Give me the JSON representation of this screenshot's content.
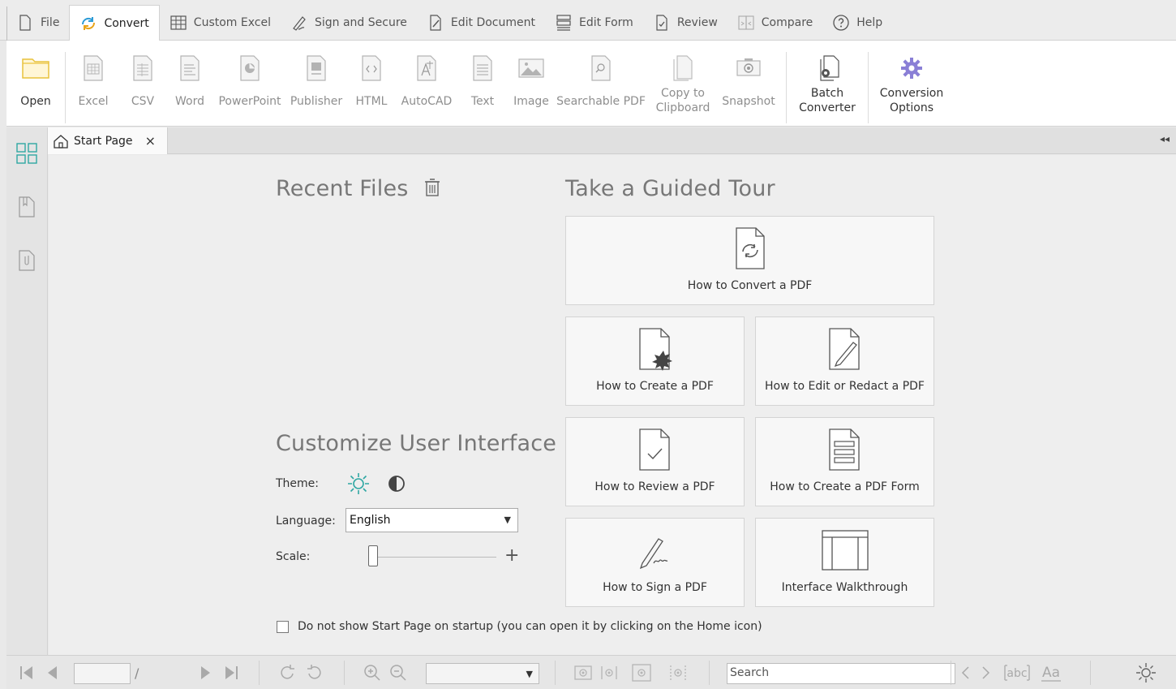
{
  "menu": {
    "tabs": [
      {
        "label": "File",
        "icon": "file-icon"
      },
      {
        "label": "Convert",
        "icon": "convert-icon"
      },
      {
        "label": "Custom Excel",
        "icon": "grid-icon"
      },
      {
        "label": "Sign and Secure",
        "icon": "signature-pen-icon"
      },
      {
        "label": "Edit Document",
        "icon": "edit-document-icon"
      },
      {
        "label": "Edit Form",
        "icon": "form-icon"
      },
      {
        "label": "Review",
        "icon": "review-check-icon"
      },
      {
        "label": "Compare",
        "icon": "compare-icon"
      },
      {
        "label": "Help",
        "icon": "help-icon"
      }
    ],
    "active": "Convert"
  },
  "ribbon": {
    "open": "Open",
    "excel": "Excel",
    "csv": "CSV",
    "word": "Word",
    "powerpoint": "PowerPoint",
    "publisher": "Publisher",
    "html": "HTML",
    "autocad": "AutoCAD",
    "text": "Text",
    "image": "Image",
    "searchable_pdf": "Searchable PDF",
    "copy_clipboard": "Copy to\nClipboard",
    "snapshot": "Snapshot",
    "batch_converter": "Batch\nConverter",
    "conversion_options": "Conversion\nOptions"
  },
  "doc_tab": {
    "label": "Start Page",
    "close": "×"
  },
  "collapse_glyph": "◂◂",
  "start_page": {
    "recent_files_title": "Recent Files",
    "guided_tour_title": "Take a Guided Tour",
    "tiles": {
      "convert": "How to Convert a PDF",
      "create": "How to Create a PDF",
      "edit": "How to Edit or Redact a PDF",
      "review": "How to Review a PDF",
      "create_form": "How to Create a PDF Form",
      "sign": "How to Sign a PDF",
      "walkthrough": "Interface Walkthrough"
    },
    "customize_title": "Customize User Interface",
    "theme_label": "Theme:",
    "language_label": "Language:",
    "language_value": "English",
    "scale_label": "Scale:",
    "scale_plus": "+",
    "scale_value": 0,
    "startup_checkbox_label": "Do not show Start Page on startup (you can open it by clicking on the Home icon)",
    "startup_checked": false
  },
  "statusbar": {
    "page_separator": "/",
    "search_placeholder": "Search"
  },
  "colors": {
    "accent_orange": "#e8a317",
    "accent_teal": "#2fa7a3",
    "accent_purple": "#8a7fd6",
    "folder_yellow": "#e9c23c"
  }
}
